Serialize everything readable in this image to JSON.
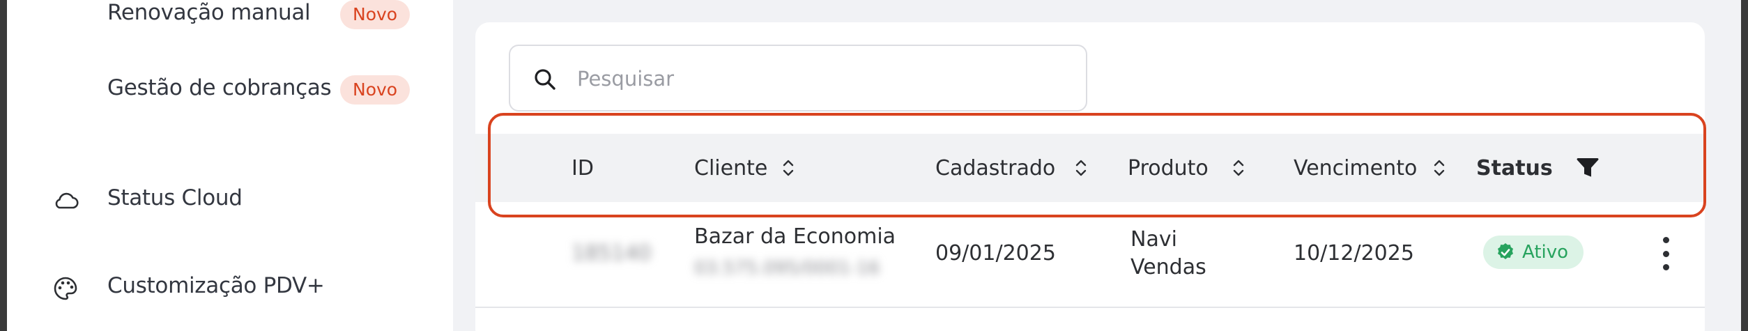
{
  "sidebar": {
    "items": [
      {
        "label": "Renovação manual",
        "badge": "Novo"
      },
      {
        "label": "Gestão de cobranças",
        "badge": "Novo"
      },
      {
        "label": "Status Cloud",
        "icon": "cloud-icon"
      },
      {
        "label": "Customização PDV+",
        "icon": "palette-icon"
      }
    ]
  },
  "search": {
    "placeholder": "Pesquisar",
    "icon": "search-icon"
  },
  "table": {
    "columns": [
      {
        "label": "ID",
        "sortable": false
      },
      {
        "label": "Cliente",
        "sortable": true
      },
      {
        "label": "Cadastrado",
        "sortable": true
      },
      {
        "label": "Produto",
        "sortable": true
      },
      {
        "label": "Vencimento",
        "sortable": true
      },
      {
        "label": "Status",
        "filterable": true
      }
    ],
    "rows": [
      {
        "id": "185140",
        "cliente_nome": "Bazar da Economia",
        "cliente_doc": "03.575.095/0001-16",
        "cadastrado": "09/01/2025",
        "produto_line1": "Navi",
        "produto_line2": "Vendas",
        "vencimento": "10/12/2025",
        "status": "Ativo"
      }
    ]
  },
  "colors": {
    "accent": "#d9431f",
    "badge_bg": "#fbe2dc",
    "status_active_bg": "#dcf3e6",
    "status_active_text": "#27a35e",
    "header_bg": "#f1f2f4"
  }
}
